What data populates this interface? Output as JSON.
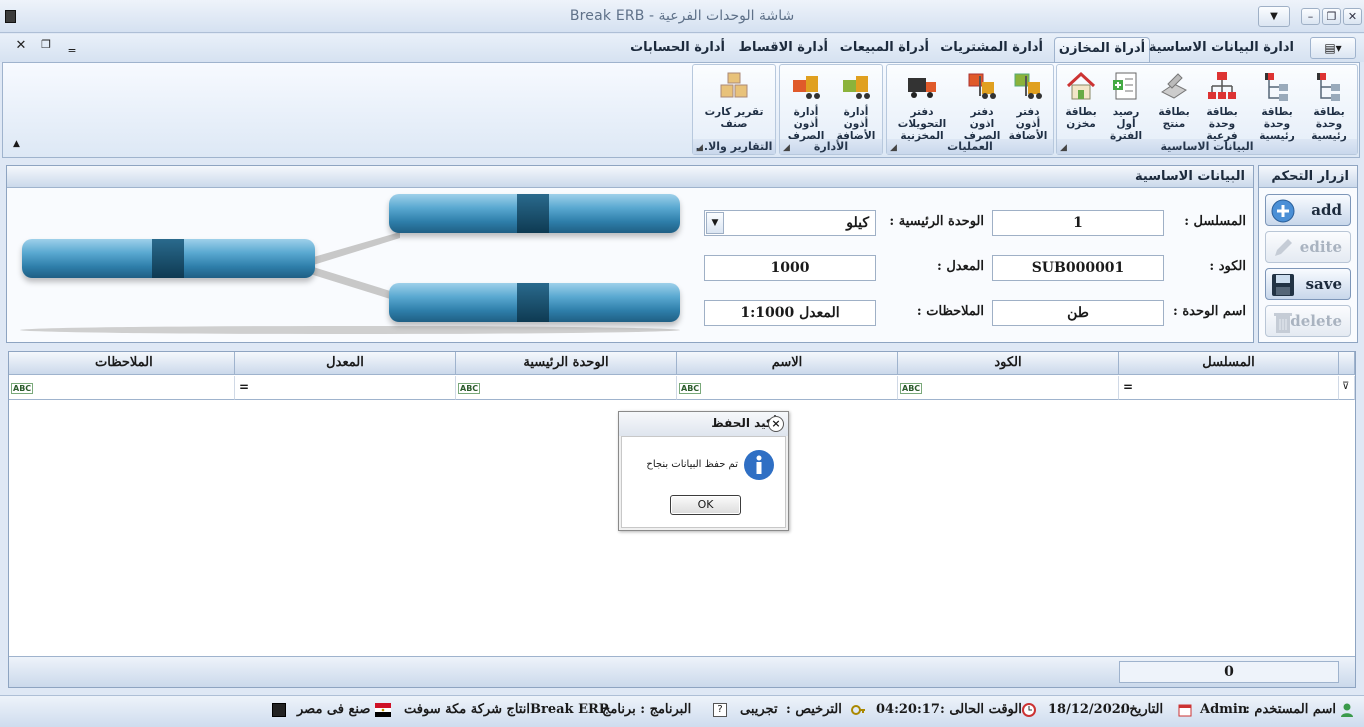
{
  "window": {
    "title": "شاشة الوحدات الفرعية  -  Break ERB"
  },
  "menu": {
    "tabs": [
      "ادارة البيانات الاساسية",
      "أدراة المخازن",
      "أدارة المشتريات",
      "أدراة المبيعات",
      "أدارة الاقساط",
      "أدارة الحسابات"
    ],
    "active_tab": "أدراة المخازن"
  },
  "ribbon": {
    "groups": [
      {
        "caption": "البيانات الاساسية",
        "buttons": [
          "بطاقة وحدة رئيسية",
          "بطاقة وحدة رئيسية",
          "بطاقة وحدة فرعية",
          "بطاقة منتج",
          "رصيد أول الفترة",
          "بطاقة مخزن"
        ]
      },
      {
        "caption": "العمليات",
        "buttons": [
          "دفتر أذون الأضافة",
          "دفتر اذون الصرف",
          "دفتر التحويلات المخزنية"
        ]
      },
      {
        "caption": "الأدارة",
        "buttons": [
          "أدارة أذون الأضافة",
          "أدارة أذون الصرف"
        ]
      },
      {
        "caption": "التقارير والا...",
        "buttons": [
          "تقرير كارت صنف"
        ]
      }
    ]
  },
  "controls": {
    "title": "ازرار التحكم",
    "add": "add",
    "edit": "edite",
    "save": "save",
    "delete": "delete"
  },
  "basic": {
    "title": "البيانات الاساسية",
    "serial_label": "المسلسل :",
    "serial_value": "1",
    "code_label": "الكود :",
    "code_value": "SUB000001",
    "unitname_label": "اسم الوحدة :",
    "unitname_value": "طن",
    "mainunit_label": "الوحدة الرئيسية :",
    "mainunit_value": "كيلو",
    "rate_label": "المعدل :",
    "rate_value": "1000",
    "notes_label": "الملاحظات :",
    "notes_value": "المعدل 1:1000"
  },
  "grid": {
    "columns": [
      "المسلسل",
      "الكود",
      "الاسم",
      "الوحدة الرئيسية",
      "المعدل",
      "الملاحظات"
    ],
    "filter_abc": "ABC",
    "footer_count": "0"
  },
  "dialog": {
    "title": "تأكيد الحفظ",
    "message": "تم حفظ البيانات بنجاح",
    "ok": "OK",
    "close": "×"
  },
  "status": {
    "user_label": "اسم المستخدم :",
    "user": "Admin",
    "date_label": "التاريخ :",
    "date": "18/12/2020",
    "time_label": "الوقت الحالى :",
    "time": "04:20:17",
    "license_label": "الترخيص :",
    "license": "تجريبى",
    "program_label": "البرنامج : برنامج",
    "program": "Break ERP",
    "company": "انتاج شركة مكة سوفت",
    "made": "صنع فى مصر"
  }
}
